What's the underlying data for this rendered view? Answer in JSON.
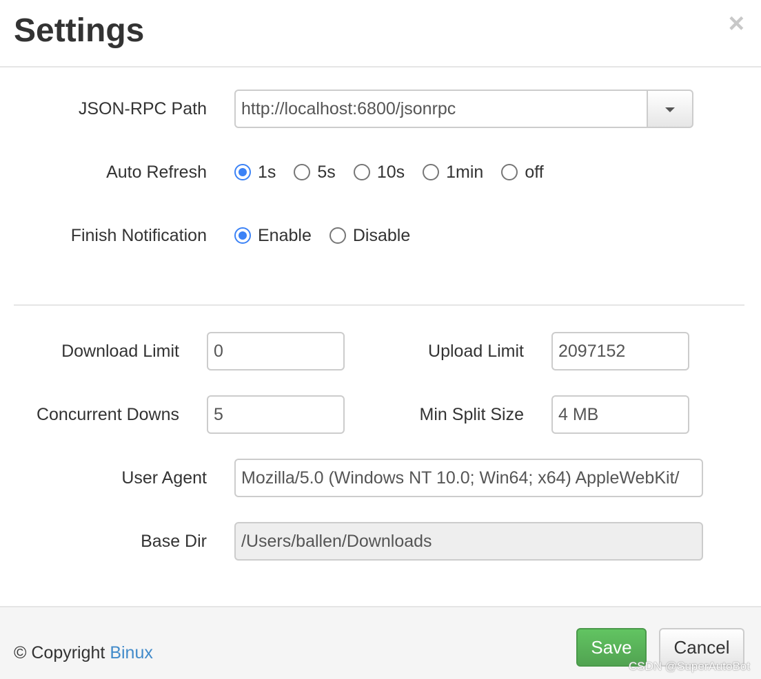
{
  "header": {
    "title": "Settings",
    "close_label": "×"
  },
  "rpc": {
    "label": "JSON-RPC Path",
    "value": "http://localhost:6800/jsonrpc"
  },
  "auto_refresh": {
    "label": "Auto Refresh",
    "options": [
      "1s",
      "5s",
      "10s",
      "1min",
      "off"
    ],
    "selected": "1s"
  },
  "finish_notification": {
    "label": "Finish Notification",
    "options": [
      "Enable",
      "Disable"
    ],
    "selected": "Enable"
  },
  "download_limit": {
    "label": "Download Limit",
    "value": "0"
  },
  "upload_limit": {
    "label": "Upload Limit",
    "value": "2097152"
  },
  "concurrent_downs": {
    "label": "Concurrent Downs",
    "value": "5"
  },
  "min_split_size": {
    "label": "Min Split Size",
    "value": "4 MB"
  },
  "user_agent": {
    "label": "User Agent",
    "value": "Mozilla/5.0 (Windows NT 10.0; Win64; x64) AppleWebKit/"
  },
  "base_dir": {
    "label": "Base Dir",
    "value": "/Users/ballen/Downloads"
  },
  "footer": {
    "copyright_prefix": "© Copyright ",
    "copyright_link": "Binux",
    "save_label": "Save",
    "cancel_label": "Cancel",
    "watermark": "CSDN @SuperAutoBot"
  },
  "colors": {
    "accent": "#3b82f6",
    "link": "#428bca",
    "save_green": "#5cb85c"
  }
}
